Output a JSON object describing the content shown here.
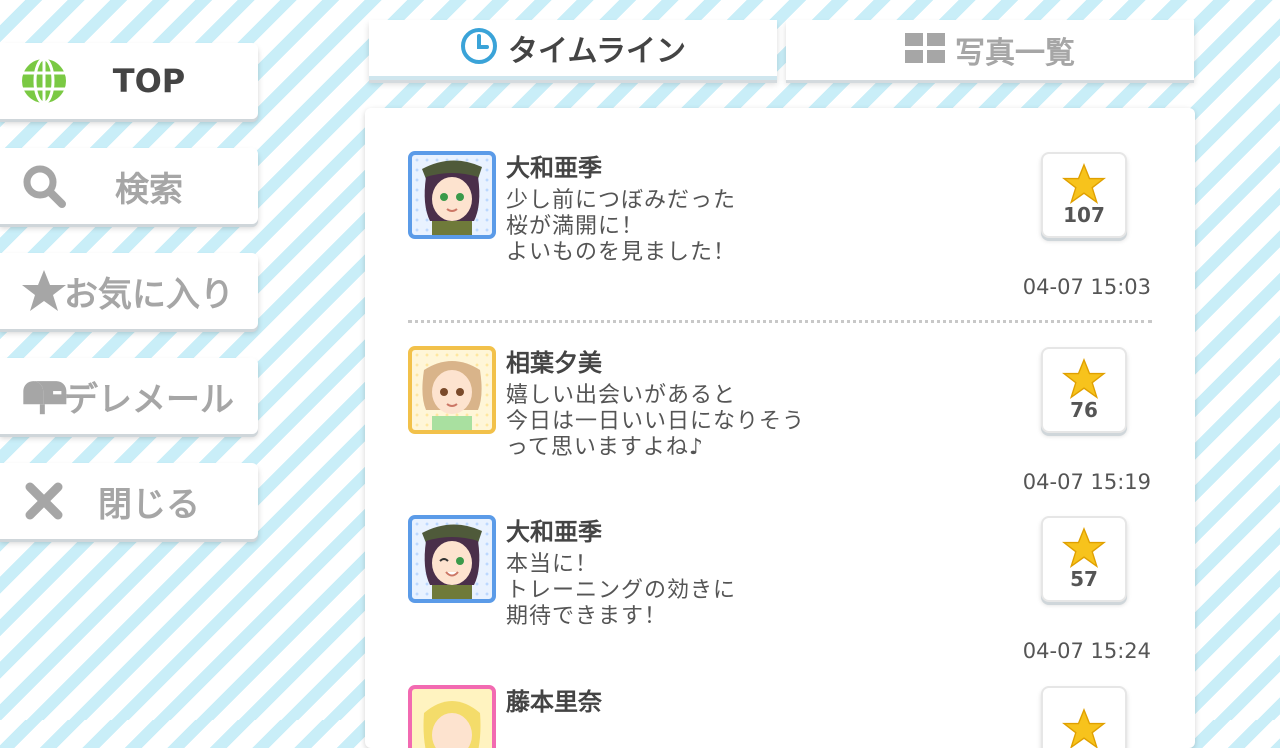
{
  "sidebar": {
    "items": [
      {
        "label": "TOP",
        "icon": "globe-icon"
      },
      {
        "label": "検索",
        "icon": "search-icon"
      },
      {
        "label": "お気に入り",
        "icon": "star-icon"
      },
      {
        "label": "デレメール",
        "icon": "mailbox-icon"
      },
      {
        "label": "閉じる",
        "icon": "close-icon"
      }
    ]
  },
  "tabs": [
    {
      "label": "タイムライン",
      "icon": "clock-icon",
      "active": true
    },
    {
      "label": "写真一覧",
      "icon": "grid-icon",
      "active": false
    }
  ],
  "posts": [
    {
      "name": "大和亜季",
      "message": "少し前につぼみだった\n桜が満開に！\nよいものを見ました！",
      "likes": "107",
      "time": "04-07 15:03"
    },
    {
      "name": "相葉夕美",
      "message": "嬉しい出会いがあると\n今日は一日いい日になりそう\nって思いますよね♪",
      "likes": "76",
      "time": "04-07 15:19"
    },
    {
      "name": "大和亜季",
      "message": "本当に！\nトレーニングの効きに\n期待できます！",
      "likes": "57",
      "time": "04-07 15:24"
    },
    {
      "name": "藤本里奈",
      "message": "",
      "likes": "",
      "time": ""
    }
  ],
  "colors": {
    "accent_green": "#7ac943",
    "star_yellow": "#f7c31c",
    "clock_blue": "#3aa3d8",
    "stripe": "#c9eef8"
  }
}
